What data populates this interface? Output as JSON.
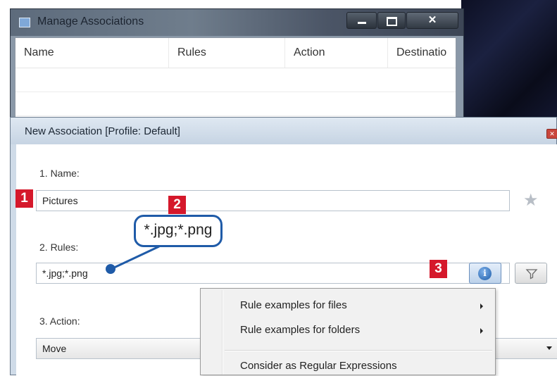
{
  "manage_window": {
    "title": "Manage Associations",
    "columns": [
      "Name",
      "Rules",
      "Action",
      "Destinatio"
    ]
  },
  "dialog": {
    "title": "New Association [Profile: Default]",
    "name_label": "1. Name:",
    "name_value": "Pictures",
    "rules_label": "2. Rules:",
    "rules_value": "*.jpg;*.png",
    "action_label": "3. Action:",
    "action_value": "Move"
  },
  "context_menu": {
    "items": [
      "Rule examples for files",
      "Rule examples for folders",
      "Consider as Regular Expressions"
    ]
  },
  "callouts": {
    "marker1": "1",
    "marker2": "2",
    "marker3": "3",
    "bubble_text": "*.jpg;*.png"
  },
  "icons": [
    "app-icon",
    "minimize-icon",
    "maximize-icon",
    "close-icon",
    "star-icon",
    "info-icon",
    "filter-icon",
    "chevron-down-icon",
    "submenu-arrow-icon"
  ],
  "colors": {
    "marker_red": "#d5182b",
    "callout_blue": "#1f5ba8"
  }
}
